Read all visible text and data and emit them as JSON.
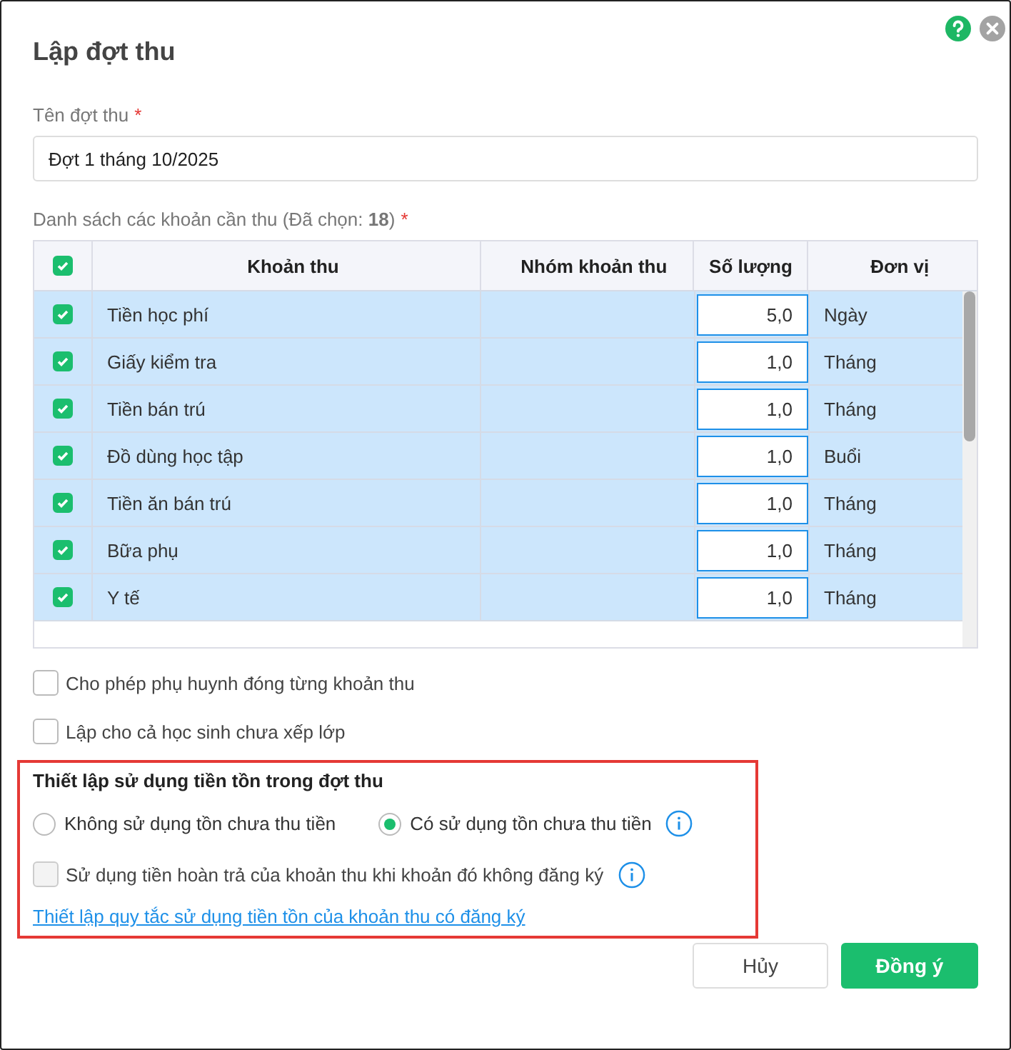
{
  "dialog": {
    "title": "Lập đợt thu"
  },
  "name_field": {
    "label": "Tên đợt thu",
    "required_mark": "*",
    "value": "Đợt 1 tháng 10/2025"
  },
  "items_list": {
    "label": "Danh sách các khoản cần thu (Đã chọn: **18**)",
    "required_mark": "*"
  },
  "table": {
    "all_checked": true,
    "columns": [
      {
        "label": "Khoản thu"
      },
      {
        "label": "Nhóm khoản thu"
      },
      {
        "label": "Số lượng"
      },
      {
        "label": "Đơn vị"
      }
    ],
    "rows": [
      {
        "checked": true,
        "item": "Tiền học phí",
        "group": "",
        "quantity": "5,0",
        "unit": "Ngày"
      },
      {
        "checked": true,
        "item": "Giấy kiểm tra",
        "group": "",
        "quantity": "1,0",
        "unit": "Tháng"
      },
      {
        "checked": true,
        "item": "Tiền bán trú",
        "group": "",
        "quantity": "1,0",
        "unit": "Tháng"
      },
      {
        "checked": true,
        "item": "Đồ dùng học tập",
        "group": "",
        "quantity": "1,0",
        "unit": "Buổi"
      },
      {
        "checked": true,
        "item": "Tiền ăn bán trú",
        "group": "",
        "quantity": "1,0",
        "unit": "Tháng"
      },
      {
        "checked": true,
        "item": "Bữa phụ",
        "group": "",
        "quantity": "1,0",
        "unit": "Tháng"
      },
      {
        "checked": true,
        "item": "Y tế",
        "group": "",
        "quantity": "1,0",
        "unit": "Tháng"
      }
    ]
  },
  "options": [
    {
      "label": "Cho phép phụ huynh đóng từng khoản thu",
      "checked": false
    },
    {
      "label": "Lập cho cả học sinh chưa xếp lớp",
      "checked": false
    }
  ],
  "balance_section": {
    "title": "Thiết lập sử dụng tiền tồn trong đợt thu",
    "radios": [
      {
        "label": "Không sử dụng tồn chưa thu tiền",
        "selected": false,
        "info": false
      },
      {
        "label": "Có sử dụng tồn chưa thu tiền",
        "selected": true,
        "info": true
      }
    ],
    "refund_option": {
      "label": "Sử dụng tiền hoàn trả của khoản thu khi khoản đó không đăng ký",
      "checked": false,
      "disabled": true,
      "info": true
    },
    "link": "Thiết lập quy tắc sử dụng tiền tồn của khoản thu có đăng ký"
  },
  "buttons": [
    {
      "label": "Hủy",
      "kind": "secondary"
    },
    {
      "label": "Đồng ý",
      "kind": "primary"
    }
  ]
}
